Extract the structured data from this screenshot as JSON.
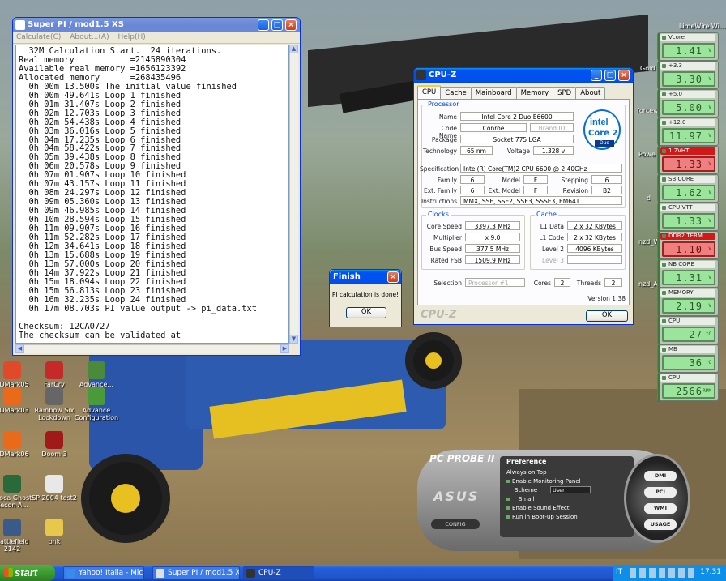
{
  "desktop_icons": [
    {
      "label": "3DMark05",
      "color": "#e04a2a"
    },
    {
      "label": "FarCry",
      "color": "#c42a2a"
    },
    {
      "label": "Advance...",
      "color": "#4a8a3a"
    },
    {
      "label": "3DMark03",
      "color": "#e86a1a"
    },
    {
      "label": "Rainbow Six Lockdown",
      "color": "#666666"
    },
    {
      "label": "Advance Configuration",
      "color": "#4a9a3a"
    },
    {
      "label": "3DMark06",
      "color": "#e86a1a"
    },
    {
      "label": "Doom 3",
      "color": "#a01a1a"
    },
    {
      "label": "Gioca Ghost Recon A...",
      "color": "#2a6a3a"
    },
    {
      "label": "SP 2004 test2",
      "color": "#e8e8e8"
    },
    {
      "label": "Battlefield 2142",
      "color": "#3a5a8a"
    },
    {
      "label": "bnk",
      "color": "#e8c84a"
    }
  ],
  "right_desktop_labels": [
    "LimeWire Wi...",
    "Gold",
    "forcew",
    "Powe",
    "d",
    "nzd_W",
    "nzd_A"
  ],
  "superpi": {
    "title": "Super PI / mod1.5 XS",
    "menu": [
      "Calculate(C)",
      "About...(A)",
      "Help(H)"
    ],
    "output": "  32M Calculation Start.  24 iterations.\nReal memory           =2145890304\nAvailable real memory =1656123392\nAllocated memory      =268435496\n  0h 00m 13.500s The initial value finished\n  0h 00m 49.641s Loop 1 finished\n  0h 01m 31.407s Loop 2 finished\n  0h 02m 12.703s Loop 3 finished\n  0h 02m 54.438s Loop 4 finished\n  0h 03m 36.016s Loop 5 finished\n  0h 04m 17.235s Loop 6 finished\n  0h 04m 58.422s Loop 7 finished\n  0h 05m 39.438s Loop 8 finished\n  0h 06m 20.578s Loop 9 finished\n  0h 07m 01.907s Loop 10 finished\n  0h 07m 43.157s Loop 11 finished\n  0h 08m 24.297s Loop 12 finished\n  0h 09m 05.360s Loop 13 finished\n  0h 09m 46.985s Loop 14 finished\n  0h 10m 28.594s Loop 15 finished\n  0h 11m 09.907s Loop 16 finished\n  0h 11m 52.282s Loop 17 finished\n  0h 12m 34.641s Loop 18 finished\n  0h 13m 15.688s Loop 19 finished\n  0h 13m 57.000s Loop 20 finished\n  0h 14m 37.922s Loop 21 finished\n  0h 15m 18.094s Loop 22 finished\n  0h 15m 56.813s Loop 23 finished\n  0h 16m 32.235s Loop 24 finished\n  0h 17m 08.703s PI value output -> pi_data.txt\n\nChecksum: 12CA0727\nThe checksum can be validated at"
  },
  "finish_dialog": {
    "title": "Finish",
    "message": "PI calculation is done!",
    "ok": "OK"
  },
  "cpuz": {
    "title": "CPU-Z",
    "tabs": [
      "CPU",
      "Cache",
      "Mainboard",
      "Memory",
      "SPD",
      "About"
    ],
    "processor_group": "Processor",
    "name_label": "Name",
    "name": "Intel Core 2 Duo E6600",
    "codename_label": "Code Name",
    "codename": "Conroe",
    "brandid_label": "Brand ID",
    "package_label": "Package",
    "package": "Socket 775 LGA",
    "technology_label": "Technology",
    "technology": "65 nm",
    "voltage_label": "Voltage",
    "voltage": "1.328 v",
    "spec_label": "Specification",
    "spec": "Intel(R) Core(TM)2 CPU        6600  @ 2.40GHz",
    "family_label": "Family",
    "family": "6",
    "model_label": "Model",
    "model": "F",
    "stepping_label": "Stepping",
    "stepping": "6",
    "extfamily_label": "Ext. Family",
    "extfamily": "6",
    "extmodel_label": "Ext. Model",
    "extmodel": "F",
    "revision_label": "Revision",
    "revision": "B2",
    "instr_label": "Instructions",
    "instr": "MMX, SSE, SSE2, SSE3, SSSE3, EM64T",
    "clocks_group": "Clocks",
    "corespeed_label": "Core Speed",
    "corespeed": "3397.3 MHz",
    "multiplier_label": "Multiplier",
    "multiplier": "x 9.0",
    "busspeed_label": "Bus Speed",
    "busspeed": "377.5 MHz",
    "ratedfsb_label": "Rated FSB",
    "ratedfsb": "1509.9 MHz",
    "cache_group": "Cache",
    "l1data_label": "L1 Data",
    "l1data": "2 x 32 KBytes",
    "l1code_label": "L1 Code",
    "l1code": "2 x 32 KBytes",
    "level2_label": "Level 2",
    "level2": "4096 KBytes",
    "level3_label": "Level 3",
    "selection_label": "Selection",
    "selection": "Processor #1",
    "cores_label": "Cores",
    "cores": "2",
    "threads_label": "Threads",
    "threads": "2",
    "version": "Version 1.38",
    "ok": "OK",
    "brand_watermark": "CPU-Z",
    "logo": {
      "brand": "intel",
      "line1": "Core 2",
      "line2": "Duo",
      "tag": "inside"
    }
  },
  "monitors": [
    {
      "label": "Vcore",
      "value": "1.41",
      "unit": "V",
      "alarm": false
    },
    {
      "label": "+3.3",
      "value": "3.30",
      "unit": "V",
      "alarm": false
    },
    {
      "label": "+5.0",
      "value": "5.00",
      "unit": "V",
      "alarm": false
    },
    {
      "label": "+12.0",
      "value": "11.97",
      "unit": "V",
      "alarm": false
    },
    {
      "label": "1.2VHT",
      "value": "1.33",
      "unit": "V",
      "alarm": true
    },
    {
      "label": "SB CORE",
      "value": "1.62",
      "unit": "V",
      "alarm": false
    },
    {
      "label": "CPU VTT",
      "value": "1.33",
      "unit": "V",
      "alarm": false
    },
    {
      "label": "DDR2 TERM",
      "value": "1.10",
      "unit": "V",
      "alarm": true
    },
    {
      "label": "NB CORE",
      "value": "1.31",
      "unit": "V",
      "alarm": false
    },
    {
      "label": "MEMORY",
      "value": "2.19",
      "unit": "V",
      "alarm": false
    },
    {
      "label": "CPU",
      "value": "27",
      "unit": "°C",
      "alarm": false
    },
    {
      "label": "MB",
      "value": "36",
      "unit": "°C",
      "alarm": false
    },
    {
      "label": "CPU",
      "value": "2566",
      "unit": "RPM",
      "alarm": false
    }
  ],
  "pcprobe": {
    "title": "PC PROBE II",
    "panel_title": "Preference",
    "options": [
      "Always on Top",
      "Enable Monitoring Panel",
      "Scheme",
      "Small",
      "Enable Sound Effect",
      "Run in Boot-up Session"
    ],
    "scheme_value": "User",
    "wheel_buttons": [
      "DMI",
      "PCI",
      "WMI",
      "USAGE"
    ],
    "config": "CONFIG",
    "brand": "ASUS"
  },
  "taskbar": {
    "start": "start",
    "items": [
      "Yahoo! Italia - Micros...",
      "Super PI / mod1.5 XS",
      "CPU-Z"
    ],
    "lang": "IT",
    "clock": "17.31"
  }
}
